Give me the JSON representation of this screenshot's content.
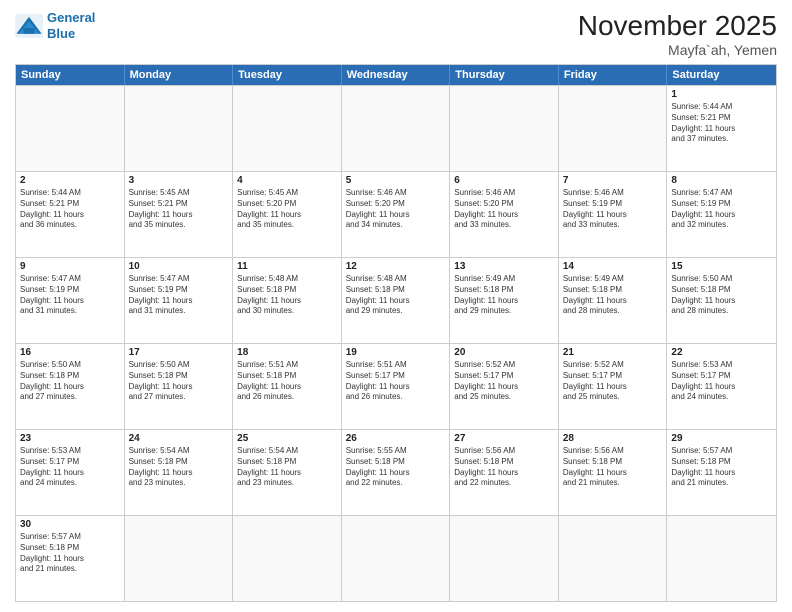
{
  "logo": {
    "line1": "General",
    "line2": "Blue"
  },
  "title": "November 2025",
  "location": "Mayfa`ah, Yemen",
  "days_of_week": [
    "Sunday",
    "Monday",
    "Tuesday",
    "Wednesday",
    "Thursday",
    "Friday",
    "Saturday"
  ],
  "rows": [
    [
      {
        "day": "",
        "info": ""
      },
      {
        "day": "",
        "info": ""
      },
      {
        "day": "",
        "info": ""
      },
      {
        "day": "",
        "info": ""
      },
      {
        "day": "",
        "info": ""
      },
      {
        "day": "",
        "info": ""
      },
      {
        "day": "1",
        "info": "Sunrise: 5:44 AM\nSunset: 5:21 PM\nDaylight: 11 hours\nand 37 minutes."
      }
    ],
    [
      {
        "day": "2",
        "info": "Sunrise: 5:44 AM\nSunset: 5:21 PM\nDaylight: 11 hours\nand 36 minutes."
      },
      {
        "day": "3",
        "info": "Sunrise: 5:45 AM\nSunset: 5:21 PM\nDaylight: 11 hours\nand 35 minutes."
      },
      {
        "day": "4",
        "info": "Sunrise: 5:45 AM\nSunset: 5:20 PM\nDaylight: 11 hours\nand 35 minutes."
      },
      {
        "day": "5",
        "info": "Sunrise: 5:46 AM\nSunset: 5:20 PM\nDaylight: 11 hours\nand 34 minutes."
      },
      {
        "day": "6",
        "info": "Sunrise: 5:46 AM\nSunset: 5:20 PM\nDaylight: 11 hours\nand 33 minutes."
      },
      {
        "day": "7",
        "info": "Sunrise: 5:46 AM\nSunset: 5:19 PM\nDaylight: 11 hours\nand 33 minutes."
      },
      {
        "day": "8",
        "info": "Sunrise: 5:47 AM\nSunset: 5:19 PM\nDaylight: 11 hours\nand 32 minutes."
      }
    ],
    [
      {
        "day": "9",
        "info": "Sunrise: 5:47 AM\nSunset: 5:19 PM\nDaylight: 11 hours\nand 31 minutes."
      },
      {
        "day": "10",
        "info": "Sunrise: 5:47 AM\nSunset: 5:19 PM\nDaylight: 11 hours\nand 31 minutes."
      },
      {
        "day": "11",
        "info": "Sunrise: 5:48 AM\nSunset: 5:18 PM\nDaylight: 11 hours\nand 30 minutes."
      },
      {
        "day": "12",
        "info": "Sunrise: 5:48 AM\nSunset: 5:18 PM\nDaylight: 11 hours\nand 29 minutes."
      },
      {
        "day": "13",
        "info": "Sunrise: 5:49 AM\nSunset: 5:18 PM\nDaylight: 11 hours\nand 29 minutes."
      },
      {
        "day": "14",
        "info": "Sunrise: 5:49 AM\nSunset: 5:18 PM\nDaylight: 11 hours\nand 28 minutes."
      },
      {
        "day": "15",
        "info": "Sunrise: 5:50 AM\nSunset: 5:18 PM\nDaylight: 11 hours\nand 28 minutes."
      }
    ],
    [
      {
        "day": "16",
        "info": "Sunrise: 5:50 AM\nSunset: 5:18 PM\nDaylight: 11 hours\nand 27 minutes."
      },
      {
        "day": "17",
        "info": "Sunrise: 5:50 AM\nSunset: 5:18 PM\nDaylight: 11 hours\nand 27 minutes."
      },
      {
        "day": "18",
        "info": "Sunrise: 5:51 AM\nSunset: 5:18 PM\nDaylight: 11 hours\nand 26 minutes."
      },
      {
        "day": "19",
        "info": "Sunrise: 5:51 AM\nSunset: 5:17 PM\nDaylight: 11 hours\nand 26 minutes."
      },
      {
        "day": "20",
        "info": "Sunrise: 5:52 AM\nSunset: 5:17 PM\nDaylight: 11 hours\nand 25 minutes."
      },
      {
        "day": "21",
        "info": "Sunrise: 5:52 AM\nSunset: 5:17 PM\nDaylight: 11 hours\nand 25 minutes."
      },
      {
        "day": "22",
        "info": "Sunrise: 5:53 AM\nSunset: 5:17 PM\nDaylight: 11 hours\nand 24 minutes."
      }
    ],
    [
      {
        "day": "23",
        "info": "Sunrise: 5:53 AM\nSunset: 5:17 PM\nDaylight: 11 hours\nand 24 minutes."
      },
      {
        "day": "24",
        "info": "Sunrise: 5:54 AM\nSunset: 5:18 PM\nDaylight: 11 hours\nand 23 minutes."
      },
      {
        "day": "25",
        "info": "Sunrise: 5:54 AM\nSunset: 5:18 PM\nDaylight: 11 hours\nand 23 minutes."
      },
      {
        "day": "26",
        "info": "Sunrise: 5:55 AM\nSunset: 5:18 PM\nDaylight: 11 hours\nand 22 minutes."
      },
      {
        "day": "27",
        "info": "Sunrise: 5:56 AM\nSunset: 5:18 PM\nDaylight: 11 hours\nand 22 minutes."
      },
      {
        "day": "28",
        "info": "Sunrise: 5:56 AM\nSunset: 5:18 PM\nDaylight: 11 hours\nand 21 minutes."
      },
      {
        "day": "29",
        "info": "Sunrise: 5:57 AM\nSunset: 5:18 PM\nDaylight: 11 hours\nand 21 minutes."
      }
    ],
    [
      {
        "day": "30",
        "info": "Sunrise: 5:57 AM\nSunset: 5:18 PM\nDaylight: 11 hours\nand 21 minutes."
      },
      {
        "day": "",
        "info": ""
      },
      {
        "day": "",
        "info": ""
      },
      {
        "day": "",
        "info": ""
      },
      {
        "day": "",
        "info": ""
      },
      {
        "day": "",
        "info": ""
      },
      {
        "day": "",
        "info": ""
      }
    ]
  ]
}
